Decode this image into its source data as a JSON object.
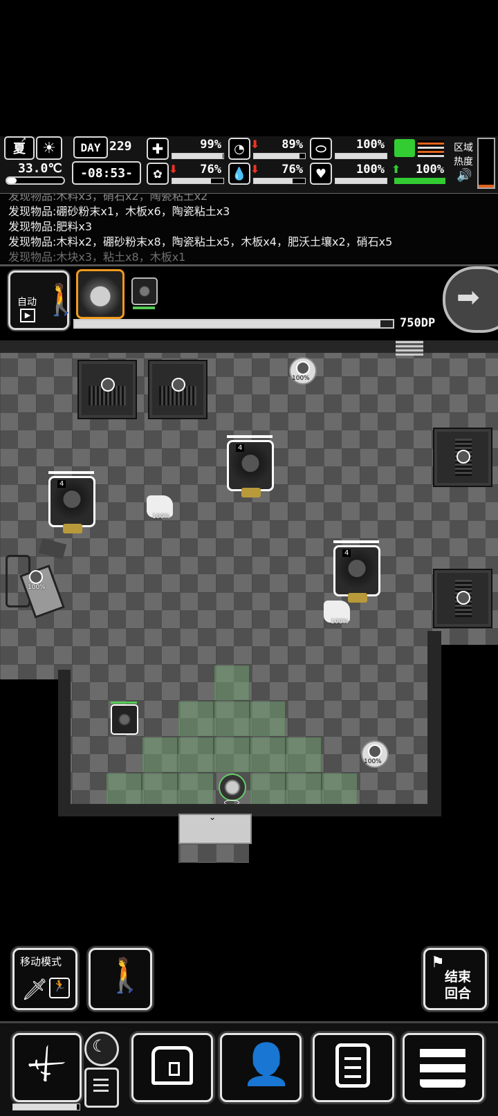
{
  "status": {
    "season": "夏",
    "temperature": "33.0℃",
    "day_label": "DAY",
    "day_number": "229",
    "time": "-08:53-",
    "health": "99%",
    "hunger": "89%",
    "armor": "100%",
    "mood": "76%",
    "thirst": "76%",
    "heart": "100%",
    "stamina": "100%",
    "zone_heat_line1": "区域",
    "zone_heat_line2": "热度",
    "colors": {
      "down_arrow": "#e32222",
      "up_arrow": "#33cc33",
      "stamina_icon": "#33cc33",
      "heat_stripe": "#e0631e"
    },
    "icons": [
      "summer-season-icon",
      "sun-icon",
      "medkit-icon",
      "stomach-icon",
      "armor-icon",
      "brain-icon",
      "water-drop-icon",
      "heart-icon",
      "boot-icon",
      "speaker-icon"
    ]
  },
  "log": {
    "lines": [
      "发现物品:木料x3，硝石x2，陶瓷粘土x2",
      "发现物品:硼砂粉末x1，木板x6，陶瓷粘土x3",
      "发现物品:肥料x3",
      "发现物品:木料x2，硼砂粉末x8，陶瓷粘土x5，木板x4，肥沃土壤x2，硝石x5",
      "发现物品:木块x3，粘土x8，木板x1"
    ]
  },
  "turn": {
    "auto_label": "自动",
    "dp": "750DP",
    "dp_progress": 0.96
  },
  "map": {
    "item_percent": "100%",
    "monster_level": "4"
  },
  "controls": {
    "move_mode": "移动模式",
    "end_turn_line1": "结束",
    "end_turn_line2": "回合"
  }
}
